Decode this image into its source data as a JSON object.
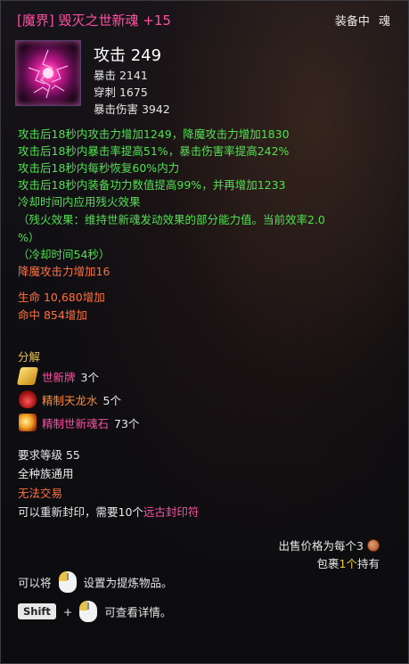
{
  "header": {
    "grade": "[魔界]",
    "name": "毁灭之世新魂",
    "enhance": "+15",
    "equipped_label": "装备中",
    "slot_label": "魂"
  },
  "stats": {
    "main": "攻击 249",
    "sub": [
      "暴击 2141",
      "穿刺 1675",
      "暴击伤害 3942"
    ]
  },
  "effects": [
    "攻击后18秒内攻击力增加1249，降魔攻击力增加1830",
    "攻击后18秒内暴击率提高51%，暴击伤害率提高242%",
    "攻击后18秒内每秒恢复60%内力",
    "攻击后18秒内装备功力数值提高99%，并再增加1233",
    "冷却时间内应用残火效果",
    "（残火效果：维持世新魂发动效果的部分能力值。当前效率2.0",
    "%）",
    "（冷却时间54秒）",
    "降魔攻击力增加16"
  ],
  "bonus": [
    "生命 10,680增加",
    "命中 854增加"
  ],
  "decompose": {
    "title": "分解",
    "items": [
      {
        "name": "世新牌",
        "count": "3个",
        "icon": "gold-token-icon",
        "color": "#ff4fa3"
      },
      {
        "name": "精制天龙水",
        "count": "5个",
        "icon": "potion-icon",
        "color": "#ff8a3a"
      },
      {
        "name": "精制世新魂石",
        "count": "73个",
        "icon": "soul-stone-icon",
        "color": "#ff4fa3"
      }
    ]
  },
  "requirements": {
    "level": "要求等级 55",
    "race": "全种族通用",
    "trade": "无法交易",
    "reseal_prefix": "可以重新封印，需要10个",
    "reseal_item": "远古封印符"
  },
  "sell": {
    "price_text": "出售价格为每个3",
    "bag_prefix": "包裹",
    "bag_count": "1个",
    "bag_suffix": "持有"
  },
  "hints": {
    "refine_prefix": "可以将",
    "refine_suffix": "设置为提炼物品。",
    "shift_key": "Shift",
    "plus": "+",
    "detail_suffix": "可查看详情。"
  }
}
